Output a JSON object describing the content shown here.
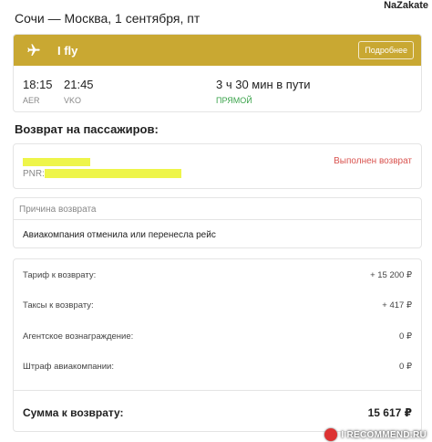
{
  "watermark_top": "NaZakate",
  "route_title": "Сочи — Москва, 1 сентября, пт",
  "flight": {
    "airline": "I fly",
    "details_label": "Подробнее",
    "depart_time": "18:15",
    "depart_airport": "AER",
    "arrive_time": "21:45",
    "arrive_airport": "VKO",
    "duration": "3 ч 30 мин в пути",
    "direct": "ПРЯМОЙ",
    "header_color": "#c9a832"
  },
  "refund_section_title": "Возврат на пассажиров:",
  "passenger": {
    "pnr_label": "PNR:",
    "status": "Выполнен возврат"
  },
  "reason": {
    "title": "Причина возврата",
    "text": "Авиакомпания отменила или перенесла рейс"
  },
  "amounts": {
    "rows": [
      {
        "label": "Тариф к возврату:",
        "value": "+ 15 200 ₽"
      },
      {
        "label": "Таксы к возврату:",
        "value": "+ 417 ₽"
      },
      {
        "label": "Агентское вознаграждение:",
        "value": "0 ₽"
      },
      {
        "label": "Штраф авиакомпании:",
        "value": "0 ₽"
      }
    ],
    "total_label": "Сумма к возврату:",
    "total_value": "15 617 ₽"
  },
  "watermark_bottom": "I RECOMMEND.RU"
}
